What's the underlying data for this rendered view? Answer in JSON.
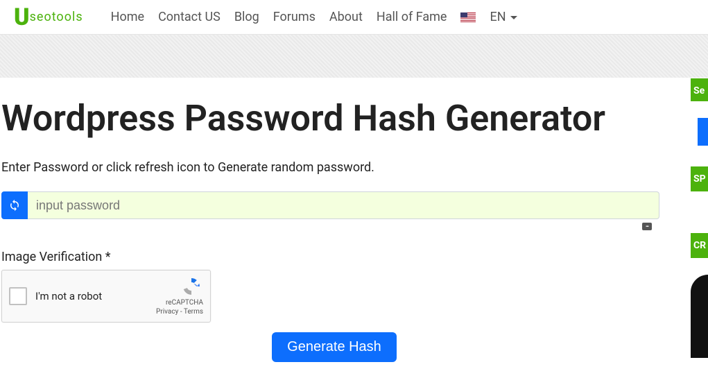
{
  "nav": {
    "logo_text": "seotools",
    "items": [
      "Home",
      "Contact US",
      "Blog",
      "Forums",
      "About",
      "Hall of Fame"
    ],
    "lang": "EN"
  },
  "page": {
    "title": "Wordpress Password Hash Generator",
    "instruction": "Enter Password or click refresh icon to Generate random password.",
    "password_placeholder": "input password",
    "verify_label": "Image Verification *",
    "generate_label": "Generate Hash"
  },
  "recaptcha": {
    "label": "I'm not a robot",
    "brand": "reCAPTCHA",
    "privacy": "Privacy",
    "terms": "Terms"
  },
  "side": {
    "a": "Se",
    "b": "SP",
    "c": "CR"
  }
}
